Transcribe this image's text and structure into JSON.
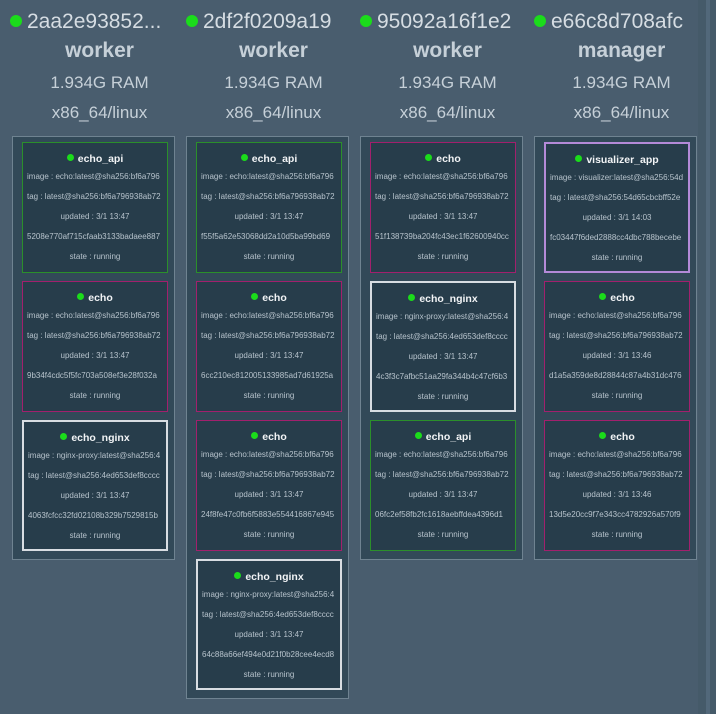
{
  "nodes": [
    {
      "id": "2aa2e93852...",
      "role": "worker",
      "ram": "1.934G RAM",
      "platform": "x86_64/linux",
      "tasks": [
        {
          "name": "echo_api",
          "image": "image : echo:latest@sha256:bf6a796",
          "tag": "tag : latest@sha256:bf6a796938ab72",
          "updated": "updated : 3/1 13:47",
          "id": "5208e770af715cfaab3133badaee887",
          "state": "state : running",
          "border": "green"
        },
        {
          "name": "echo",
          "image": "image : echo:latest@sha256:bf6a796",
          "tag": "tag : latest@sha256:bf6a796938ab72",
          "updated": "updated : 3/1 13:47",
          "id": "9b34f4cdc5f5fc703a508ef3e28f032a",
          "state": "state : running",
          "border": "magenta"
        },
        {
          "name": "echo_nginx",
          "image": "image : nginx-proxy:latest@sha256:4",
          "tag": "tag : latest@sha256:4ed653def8cccc",
          "updated": "updated : 3/1 13:47",
          "id": "4063fcfcc32fd02108b329b7529815b",
          "state": "state : running",
          "border": "white"
        }
      ]
    },
    {
      "id": "2df2f0209a19",
      "role": "worker",
      "ram": "1.934G RAM",
      "platform": "x86_64/linux",
      "tasks": [
        {
          "name": "echo_api",
          "image": "image : echo:latest@sha256:bf6a796",
          "tag": "tag : latest@sha256:bf6a796938ab72",
          "updated": "updated : 3/1 13:47",
          "id": "f55f5a62e53068dd2a10d5ba99bd69",
          "state": "state : running",
          "border": "green"
        },
        {
          "name": "echo",
          "image": "image : echo:latest@sha256:bf6a796",
          "tag": "tag : latest@sha256:bf6a796938ab72",
          "updated": "updated : 3/1 13:47",
          "id": "6cc210ec812005133985ad7d61925a",
          "state": "state : running",
          "border": "magenta"
        },
        {
          "name": "echo",
          "image": "image : echo:latest@sha256:bf6a796",
          "tag": "tag : latest@sha256:bf6a796938ab72",
          "updated": "updated : 3/1 13:47",
          "id": "24f8fe47c0fb6f5883e554416867e945",
          "state": "state : running",
          "border": "magenta"
        },
        {
          "name": "echo_nginx",
          "image": "image : nginx-proxy:latest@sha256:4",
          "tag": "tag : latest@sha256:4ed653def8cccc",
          "updated": "updated : 3/1 13:47",
          "id": "64c88a66ef494e0d21f0b28cee4ecd8",
          "state": "state : running",
          "border": "white"
        }
      ]
    },
    {
      "id": "95092a16f1e2",
      "role": "worker",
      "ram": "1.934G RAM",
      "platform": "x86_64/linux",
      "tasks": [
        {
          "name": "echo",
          "image": "image : echo:latest@sha256:bf6a796",
          "tag": "tag : latest@sha256:bf6a796938ab72",
          "updated": "updated : 3/1 13:47",
          "id": "51f138739ba204fc43ec1f62600940cc",
          "state": "state : running",
          "border": "magenta"
        },
        {
          "name": "echo_nginx",
          "image": "image : nginx-proxy:latest@sha256:4",
          "tag": "tag : latest@sha256:4ed653def8cccc",
          "updated": "updated : 3/1 13:47",
          "id": "4c3f3c7afbc51aa29fa344b4c47cf6b3",
          "state": "state : running",
          "border": "white"
        },
        {
          "name": "echo_api",
          "image": "image : echo:latest@sha256:bf6a796",
          "tag": "tag : latest@sha256:bf6a796938ab72",
          "updated": "updated : 3/1 13:47",
          "id": "06fc2ef58fb2fc1618aebffdea4396d1",
          "state": "state : running",
          "border": "green"
        }
      ]
    },
    {
      "id": "e66c8d708afc",
      "role": "manager",
      "ram": "1.934G RAM",
      "platform": "x86_64/linux",
      "tasks": [
        {
          "name": "visualizer_app",
          "image": "image : visualizer:latest@sha256:54d",
          "tag": "tag : latest@sha256:54d65cbcbff52e",
          "updated": "updated : 3/1 14:03",
          "id": "fc03447f6ded2888cc4dbc788becebe",
          "state": "state : running",
          "border": "violet"
        },
        {
          "name": "echo",
          "image": "image : echo:latest@sha256:bf6a796",
          "tag": "tag : latest@sha256:bf6a796938ab72",
          "updated": "updated : 3/1 13:46",
          "id": "d1a5a359de8d28844c87a4b31dc476",
          "state": "state : running",
          "border": "magenta"
        },
        {
          "name": "echo",
          "image": "image : echo:latest@sha256:bf6a796",
          "tag": "tag : latest@sha256:bf6a796938ab72",
          "updated": "updated : 3/1 13:46",
          "id": "13d5e20cc9f7e343cc4782926a570f9",
          "state": "state : running",
          "border": "magenta"
        }
      ]
    }
  ],
  "colors": {
    "background": "#495d6e",
    "status_dot": "#1bdc1b",
    "border_green": "#2b8f2b",
    "border_magenta": "#a2206d",
    "border_white": "#d8dde2",
    "border_violet": "#b48ad8"
  },
  "icons": {
    "status": "status-dot-icon"
  }
}
